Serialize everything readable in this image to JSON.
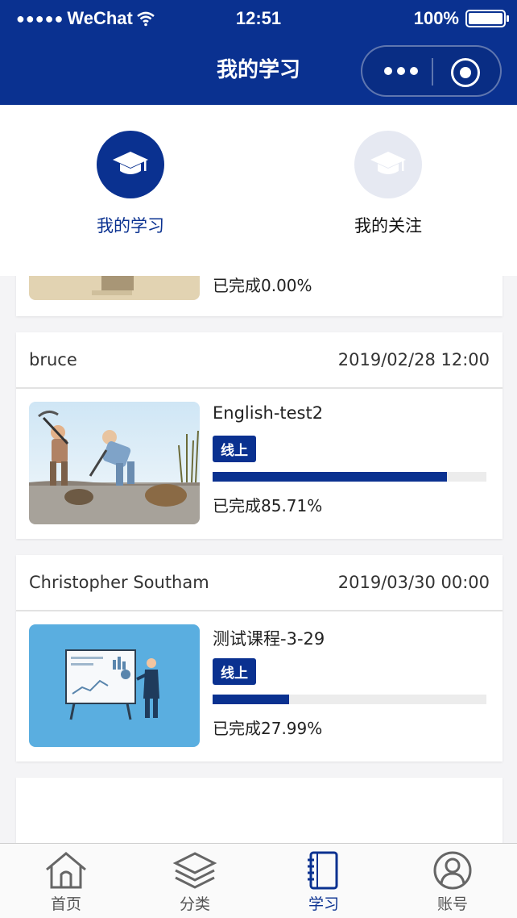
{
  "status_bar": {
    "carrier": "WeChat",
    "time": "12:51",
    "battery": "100%"
  },
  "nav": {
    "title": "我的学习"
  },
  "top_tabs": [
    {
      "label": "我的学习",
      "icon": "graduation-cap-icon",
      "active": true
    },
    {
      "label": "我的关注",
      "icon": "graduation-cap-icon",
      "active": false
    }
  ],
  "partial_card": {
    "progress_text": "已完成0.00%"
  },
  "courses": [
    {
      "author": "bruce",
      "date": "2019/02/28 12:00",
      "title": "English-test2",
      "badge": "线上",
      "progress": 0.8571,
      "progress_text": "已完成85.71%",
      "thumbnail": "digging-cartoon-thumbnail"
    },
    {
      "author": "Christopher Southam",
      "date": "2019/03/30 00:00",
      "title": "测试课程-3-29",
      "badge": "线上",
      "progress": 0.2799,
      "progress_text": "已完成27.99%",
      "thumbnail": "presentation-board-thumbnail"
    }
  ],
  "tabbar": [
    {
      "label": "首页",
      "icon": "home-icon",
      "active": false
    },
    {
      "label": "分类",
      "icon": "layers-icon",
      "active": false
    },
    {
      "label": "学习",
      "icon": "notebook-icon",
      "active": true
    },
    {
      "label": "账号",
      "icon": "user-icon",
      "active": false
    }
  ],
  "colors": {
    "brand": "#0a3190",
    "inactive_tab_circle": "#e6e9f2"
  }
}
